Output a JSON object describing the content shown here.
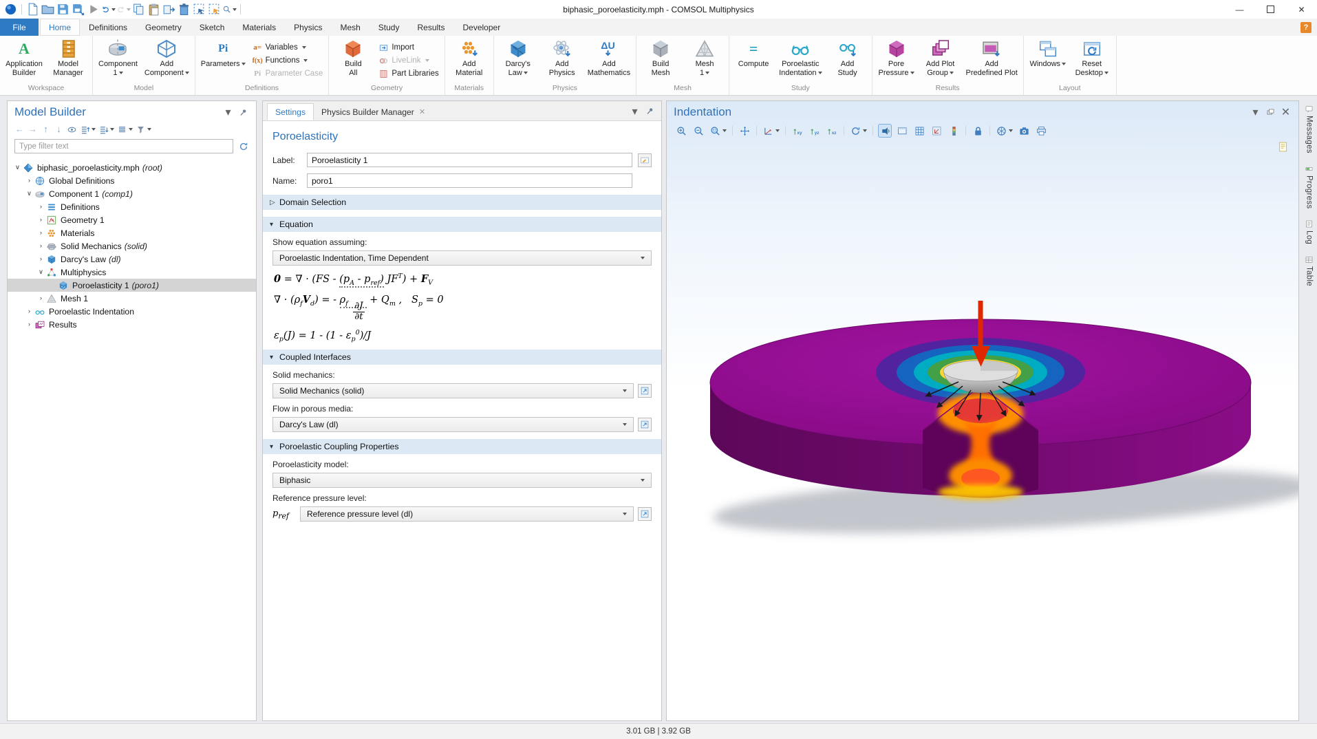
{
  "window": {
    "title": "biphasic_poroelasticity.mph - COMSOL Multiphysics",
    "controls": [
      "minimize",
      "maximize",
      "close"
    ]
  },
  "colors": {
    "accent_blue": "#2e7bc4",
    "file_tab_blue": "#2e7bc4",
    "selection_gray": "#d4d4d4",
    "section_header_blue": "#dde8f5",
    "disk_purple": "#8e0c8c",
    "graphics_bg_top": "#dce9f7",
    "compute_teal": "#18a0b8",
    "results_magenta": "#b5439f"
  },
  "qat": [
    {
      "name": "comsol-logo-icon",
      "icon": "logo",
      "interactable": false
    },
    {
      "name": "qat-separator",
      "icon": "sep"
    },
    {
      "name": "new-file-button",
      "icon": "file"
    },
    {
      "name": "open-button",
      "icon": "folder"
    },
    {
      "name": "save-button",
      "icon": "save"
    },
    {
      "name": "save-image-button",
      "icon": "saveimg"
    },
    {
      "name": "run-button",
      "icon": "play"
    },
    {
      "name": "undo-button",
      "icon": "undo",
      "caret": true
    },
    {
      "name": "redo-button",
      "icon": "redo",
      "caret": true,
      "disabled": true
    },
    {
      "name": "copy-button",
      "icon": "copy"
    },
    {
      "name": "paste-button",
      "icon": "paste"
    },
    {
      "name": "duplicate-button",
      "icon": "duplicate"
    },
    {
      "name": "delete-button",
      "icon": "trash"
    },
    {
      "name": "select-box-button",
      "icon": "selframe"
    },
    {
      "name": "select-pointer-button",
      "icon": "selpointer"
    },
    {
      "name": "zoom-select-button",
      "icon": "zoomsel",
      "caret": true
    },
    {
      "name": "qat-separator",
      "icon": "sep"
    }
  ],
  "menu": {
    "tabs": [
      {
        "label": "File",
        "style": "file"
      },
      {
        "label": "Home",
        "active": true
      },
      {
        "label": "Definitions"
      },
      {
        "label": "Geometry"
      },
      {
        "label": "Sketch"
      },
      {
        "label": "Materials"
      },
      {
        "label": "Physics"
      },
      {
        "label": "Mesh"
      },
      {
        "label": "Study"
      },
      {
        "label": "Results"
      },
      {
        "label": "Developer"
      }
    ],
    "help_label": "?"
  },
  "ribbon": {
    "groups": [
      {
        "label": "Workspace",
        "big": [
          {
            "icon": "appbuilder",
            "lines": [
              "Application",
              "Builder"
            ]
          },
          {
            "icon": "modelmanager",
            "lines": [
              "Model",
              "Manager"
            ]
          }
        ]
      },
      {
        "label": "Model",
        "big": [
          {
            "icon": "component",
            "lines": [
              "Component",
              "1"
            ],
            "caret": true
          },
          {
            "icon": "addcomponent",
            "lines": [
              "Add",
              "Component"
            ],
            "caret": true
          }
        ]
      },
      {
        "label": "Definitions",
        "big": [
          {
            "icon": "parameters",
            "lines": [
              "Parameters"
            ],
            "caret": true
          }
        ],
        "stack": [
          {
            "icon": "variables",
            "label": "Variables",
            "caret": true
          },
          {
            "icon": "functions",
            "label": "Functions",
            "caret": true
          },
          {
            "icon": "paramcase",
            "label": "Parameter Case",
            "disabled": true
          }
        ]
      },
      {
        "label": "Geometry",
        "big": [
          {
            "icon": "buildall",
            "lines": [
              "Build",
              "All"
            ]
          }
        ],
        "stack": [
          {
            "icon": "import",
            "label": "Import"
          },
          {
            "icon": "livelink",
            "label": "LiveLink",
            "caret": true,
            "disabled": true
          },
          {
            "icon": "partlib",
            "label": "Part Libraries"
          }
        ]
      },
      {
        "label": "Materials",
        "big": [
          {
            "icon": "addmaterial",
            "lines": [
              "Add",
              "Material"
            ]
          }
        ]
      },
      {
        "label": "Physics",
        "big": [
          {
            "icon": "darcycube",
            "lines": [
              "Darcy's",
              "Law"
            ],
            "caret": true
          },
          {
            "icon": "addphysics",
            "lines": [
              "Add",
              "Physics"
            ]
          },
          {
            "icon": "addmath",
            "lines": [
              "Add",
              "Mathematics"
            ]
          }
        ]
      },
      {
        "label": "Mesh",
        "big": [
          {
            "icon": "buildmesh",
            "lines": [
              "Build",
              "Mesh"
            ]
          },
          {
            "icon": "meshtri",
            "lines": [
              "Mesh",
              "1"
            ],
            "caret": true
          }
        ]
      },
      {
        "label": "Study",
        "big": [
          {
            "icon": "compute",
            "lines": [
              "Compute"
            ]
          },
          {
            "icon": "glasses",
            "lines": [
              "Poroelastic",
              "Indentation"
            ],
            "caret": true
          },
          {
            "icon": "addstudy",
            "lines": [
              "Add",
              "Study"
            ]
          }
        ]
      },
      {
        "label": "Results",
        "big": [
          {
            "icon": "porepressure",
            "lines": [
              "Pore",
              "Pressure"
            ],
            "caret": true
          },
          {
            "icon": "addplotgroup",
            "lines": [
              "Add Plot",
              "Group"
            ],
            "caret": true
          },
          {
            "icon": "addpredef",
            "lines": [
              "Add",
              "Predefined Plot"
            ]
          }
        ]
      },
      {
        "label": "Layout",
        "big": [
          {
            "icon": "windows",
            "lines": [
              "Windows"
            ],
            "caret": true
          },
          {
            "icon": "resetdesktop",
            "lines": [
              "Reset",
              "Desktop"
            ],
            "caret": true
          }
        ]
      }
    ]
  },
  "model_builder": {
    "title": "Model Builder",
    "filter_placeholder": "Type filter text",
    "toolbar": [
      {
        "name": "go-back-button",
        "icon": "aleft"
      },
      {
        "name": "go-forward-button",
        "icon": "aright"
      },
      {
        "name": "move-up-button",
        "icon": "aup"
      },
      {
        "name": "move-down-button",
        "icon": "adown"
      },
      {
        "name": "show-button",
        "icon": "eye"
      },
      {
        "name": "expand-button",
        "icon": "expand",
        "caret": true
      },
      {
        "name": "collapse-button",
        "icon": "collapse",
        "caret": true
      },
      {
        "name": "node-grouping-button",
        "icon": "list",
        "caret": true
      },
      {
        "name": "filter-tree-button",
        "icon": "funnel",
        "caret": true
      }
    ],
    "tree": [
      {
        "depth": 0,
        "exp": "open",
        "icon": "root",
        "label": "biphasic_poroelasticity.mph",
        "suffix": "(root)"
      },
      {
        "depth": 1,
        "exp": "closed",
        "icon": "globe",
        "label": "Global Definitions"
      },
      {
        "depth": 1,
        "exp": "open",
        "icon": "compnode",
        "label": "Component 1",
        "suffix": "(comp1)"
      },
      {
        "depth": 2,
        "exp": "closed",
        "icon": "defs",
        "label": "Definitions"
      },
      {
        "depth": 2,
        "exp": "closed",
        "icon": "geom",
        "label": "Geometry 1"
      },
      {
        "depth": 2,
        "exp": "closed",
        "icon": "materials",
        "label": "Materials"
      },
      {
        "depth": 2,
        "exp": "closed",
        "icon": "solidmech",
        "label": "Solid Mechanics",
        "suffix": "(solid)"
      },
      {
        "depth": 2,
        "exp": "closed",
        "icon": "darcysm",
        "label": "Darcy's Law",
        "suffix": "(dl)"
      },
      {
        "depth": 2,
        "exp": "open",
        "icon": "multiphys",
        "label": "Multiphysics"
      },
      {
        "depth": 3,
        "exp": "none",
        "icon": "poronode",
        "label": "Poroelasticity 1",
        "suffix": "(poro1)",
        "selected": true
      },
      {
        "depth": 2,
        "exp": "closed",
        "icon": "meshnode",
        "label": "Mesh 1"
      },
      {
        "depth": 1,
        "exp": "closed",
        "icon": "glassessm",
        "label": "Poroelastic Indentation"
      },
      {
        "depth": 1,
        "exp": "closed",
        "icon": "resultsnode",
        "label": "Results"
      }
    ]
  },
  "settings": {
    "tabs": {
      "settings": "Settings",
      "physics_builder": "Physics Builder Manager"
    },
    "heading": "Poroelasticity",
    "label_field": {
      "label": "Label:",
      "value": "Poroelasticity 1"
    },
    "name_field": {
      "label": "Name:",
      "value": "poro1"
    },
    "domain_selection": {
      "title": "Domain Selection"
    },
    "equation": {
      "title": "Equation",
      "show_label": "Show equation assuming:",
      "dropdown_value": "Poroelastic Indentation, Time Dependent",
      "eq1": "*{0} = ∇ · (FS - [[(p_{A} - p_{ref})]] JF^{T}) + *{F}_{V}",
      "eq2": "∇ · (ρ_{f}*{V}_{d}) = - [[ρ_{f} {{∂J||∂t}}]] + Q_{m} ,   S_{p} = 0",
      "eq3": "ε_{p}(J) = 1 - (1 - ε_{p}^{0})/J"
    },
    "coupled_interfaces": {
      "title": "Coupled Interfaces",
      "solid_label": "Solid mechanics:",
      "solid_value": "Solid Mechanics (solid)",
      "flow_label": "Flow in porous media:",
      "flow_value": "Darcy's Law (dl)"
    },
    "coupling_properties": {
      "title": "Poroelastic Coupling Properties",
      "model_label": "Poroelasticity model:",
      "model_value": "Biphasic",
      "ref_label": "Reference pressure level:",
      "ref_prefix": "p_{ref}",
      "ref_value": "Reference pressure level (dl)"
    }
  },
  "graphics": {
    "title": "Indentation",
    "toolbar": [
      {
        "name": "zoom-in-button",
        "icon": "zin"
      },
      {
        "name": "zoom-out-button",
        "icon": "zout"
      },
      {
        "name": "zoom-box-button",
        "icon": "zbox",
        "caret": true
      },
      {
        "name": "toolbar-separator",
        "icon": "sep"
      },
      {
        "name": "zoom-extents-button",
        "icon": "extents"
      },
      {
        "name": "toolbar-separator",
        "icon": "sep"
      },
      {
        "name": "go-to-view-button",
        "icon": "gotoview",
        "caret": true
      },
      {
        "name": "toolbar-separator",
        "icon": "sep"
      },
      {
        "name": "view-xy-button",
        "icon": "vxy"
      },
      {
        "name": "view-yz-button",
        "icon": "vyz"
      },
      {
        "name": "view-xz-button",
        "icon": "vxz"
      },
      {
        "name": "toolbar-separator",
        "icon": "sep"
      },
      {
        "name": "rotate-button",
        "icon": "rotate",
        "caret": true
      },
      {
        "name": "toolbar-separator",
        "icon": "sep"
      },
      {
        "name": "transparency-button",
        "icon": "transp",
        "active": true
      },
      {
        "name": "scene-light-button",
        "icon": "scenewin"
      },
      {
        "name": "grid-button",
        "icon": "grid"
      },
      {
        "name": "plot-arrows-button",
        "icon": "plotarr"
      },
      {
        "name": "color-legend-button",
        "icon": "colorbar"
      },
      {
        "name": "toolbar-separator",
        "icon": "sep"
      },
      {
        "name": "lock-view-button",
        "icon": "lock"
      },
      {
        "name": "toolbar-separator",
        "icon": "sep"
      },
      {
        "name": "color-theme-button",
        "icon": "theme",
        "caret": true
      },
      {
        "name": "snapshot-button",
        "icon": "camera"
      },
      {
        "name": "print-button",
        "icon": "printer"
      }
    ]
  },
  "side_tabs": [
    {
      "label": "Messages",
      "icon": "msg"
    },
    {
      "label": "Progress",
      "icon": "prog"
    },
    {
      "label": "Log",
      "icon": "log"
    },
    {
      "label": "Table",
      "icon": "tbl"
    }
  ],
  "status_bar": {
    "memory": "3.01 GB | 3.92 GB"
  }
}
